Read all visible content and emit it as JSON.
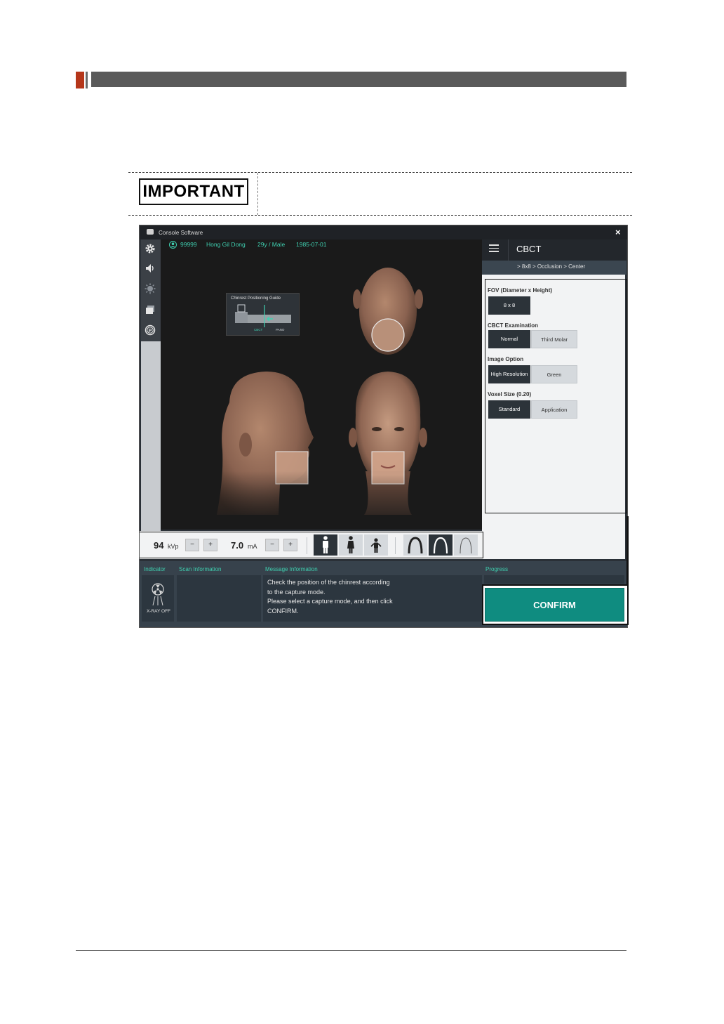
{
  "important_label": "IMPORTANT",
  "window": {
    "title": "Console Software",
    "close_glyph": "×"
  },
  "patient": {
    "id": "99999",
    "name": "Hong Gil Dong",
    "age_sex": "29y / Male",
    "birth": "1985-07-01"
  },
  "left_toolbar": [
    "gear-icon",
    "speaker-icon",
    "sun-icon",
    "layers-icon",
    "parking-icon"
  ],
  "chinrest_guide": {
    "title": "Chinrest Positioning Guide",
    "label_cbct": "CBCT",
    "label_pano": "PANO"
  },
  "right_panel": {
    "title": "CBCT",
    "breadcrumb": "> 8x8 > Occlusion > Center",
    "fov_title": "FOV (Diameter x Height)",
    "fov_option": "8 x 8",
    "exam_title": "CBCT Examination",
    "exam_options": [
      "Normal",
      "Third Molar"
    ],
    "image_title": "Image Option",
    "image_options": [
      "High Resolution",
      "Green"
    ],
    "voxel_title": "Voxel Size (0.20)",
    "voxel_options": [
      "Standard",
      "Application"
    ]
  },
  "toolbar": {
    "kvp_value": "94",
    "kvp_unit": "kVp",
    "ma_value": "7.0",
    "ma_unit": "mA",
    "minus": "−",
    "plus": "+"
  },
  "status": {
    "indicator_label": "Indicator",
    "scan_label": "Scan Information",
    "message_label": "Message Information",
    "progress_label": "Progress",
    "xray_state": "X-RAY OFF",
    "message_lines": [
      "Check the position of the chinrest according",
      "to the capture mode.",
      "Please select a capture mode, and then click",
      "CONFIRM."
    ]
  },
  "confirm_label": "CONFIRM",
  "colors": {
    "accent": "#3fd0b0",
    "confirm": "#0f8c80",
    "selected": "#2c3339"
  }
}
